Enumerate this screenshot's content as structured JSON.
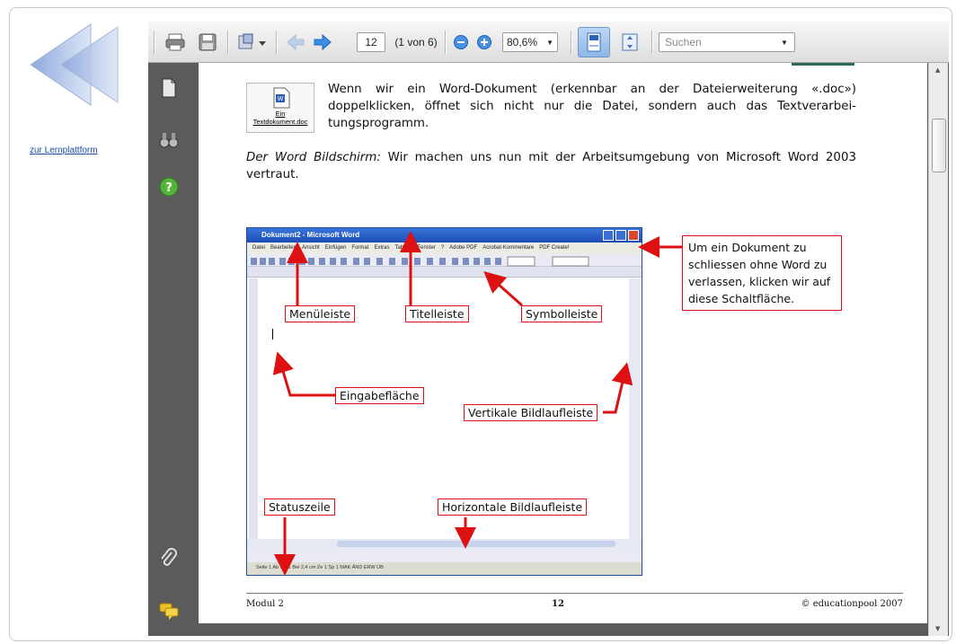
{
  "nav": {
    "link_text": "zur Lernplattform"
  },
  "toolbar": {
    "page_number": "12",
    "page_of": "(1 von 6)",
    "zoom": "80,6%",
    "search_placeholder": "Suchen"
  },
  "document": {
    "icon_caption_1": "Ein",
    "icon_caption_2": "Textdokument.doc",
    "intro_text": "Wenn wir ein Word-Dokument (erkennbar an der Dateierweiterung «.doc») doppelklicken, öffnet sich nicht nur die Datei, sondern auch das Textverarbei-tungsprogramm.",
    "section_title": "Der Word Bildschirm:",
    "section_text": " Wir machen uns nun mit der Arbeitsumgebung von Microsoft Word 2003 vertraut.",
    "word_window_title": "Dokument2 - Microsoft Word",
    "word_menu": [
      "Datei",
      "Bearbeiten",
      "Ansicht",
      "Einfügen",
      "Format",
      "Extras",
      "Tabelle",
      "Fenster",
      "?",
      "Adobe PDF",
      "Acrobat-Kommentare",
      "PDF Create!"
    ],
    "word_status": "Seite 1      Ab 1      1/1      Bei 2,4 cm   Ze 1   Sp 1       MAK  ÄND  ERW  ÜB",
    "labels": {
      "menueleiste": "Menüleiste",
      "titelleiste": "Titelleiste",
      "symbolleiste": "Symbolleiste",
      "eingabeflaeche": "Eingabefläche",
      "vertikale": "Vertikale Bildlaufleiste",
      "statuszeile": "Statuszeile",
      "horizontale": "Horizontale Bildlaufleiste"
    },
    "callout": "Um ein Dokument zu schliessen ohne Word zu verlassen, klicken wir auf diese Schaltfläche.",
    "footer_left": "Modul 2",
    "footer_center": "12",
    "footer_right": "© educationpool 2007"
  },
  "colors": {
    "accent_red": "#d11111",
    "viewer_gray": "#5b5b5b",
    "link_blue": "#1a4ea8"
  }
}
